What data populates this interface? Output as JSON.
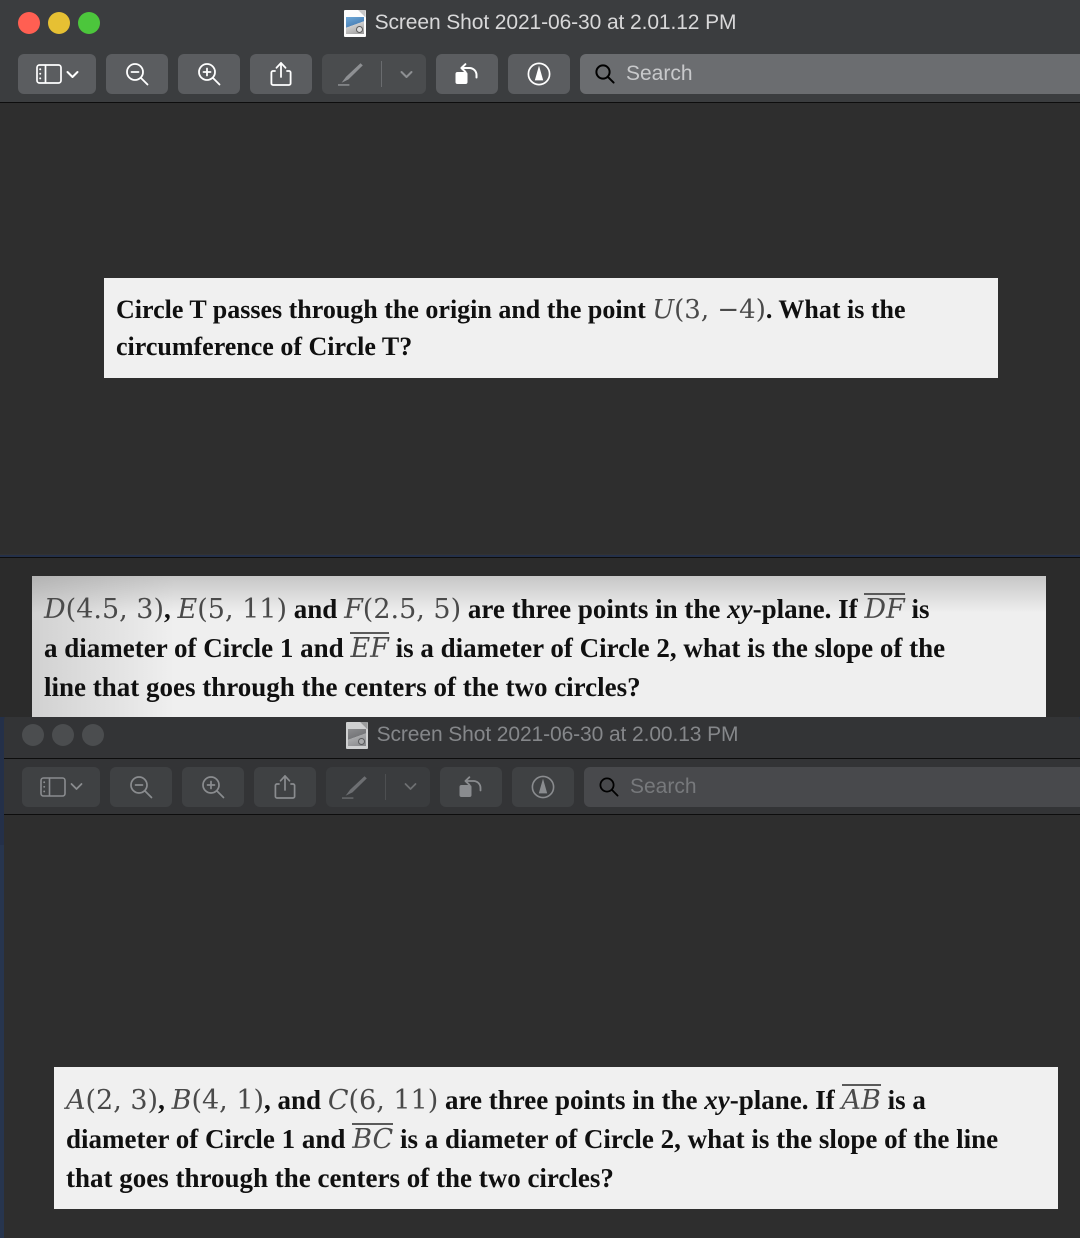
{
  "desktop": {
    "background_color": "#243049",
    "canvas_color": "#2e2e2e"
  },
  "windows": [
    {
      "id": "preview-window-front",
      "state": "active",
      "title": "Screen Shot 2021-06-30 at 2.01.12 PM",
      "title_icon": "preview-document-icon",
      "traffic_lights": {
        "close_label": "Close",
        "minimize_label": "Minimize",
        "maximize_label": "Zoom",
        "close_color": "#ff5f52",
        "minimize_color": "#e6c033",
        "maximize_color": "#4cc63c"
      },
      "toolbar": {
        "sidebar_label": "Sidebar",
        "zoom_out_label": "Zoom Out",
        "zoom_in_label": "Zoom In",
        "share_label": "Share",
        "markup_label": "Markup",
        "markup_menu_label": "Markup Options",
        "rotate_label": "Rotate Left",
        "annotate_label": "Annotate",
        "search_placeholder": "Search",
        "search_value": ""
      },
      "content": {
        "snippet": {
          "lines": [
            [
              {
                "t": "text",
                "v": "Circle T passes through the origin and the point "
              },
              {
                "t": "math",
                "v": "U"
              },
              {
                "t": "math",
                "v": "(3, −4)"
              },
              {
                "t": "text",
                "v": ". What is the"
              }
            ],
            [
              {
                "t": "text",
                "v": "circumference of Circle T?"
              }
            ]
          ],
          "plain": "Circle T passes through the origin and the point U(3, −4). What is the circumference of Circle T?"
        }
      }
    },
    {
      "id": "preview-window-middle",
      "state": "background",
      "content": {
        "snippet": {
          "lines": [
            [
              {
                "t": "math",
                "v": "D"
              },
              {
                "t": "math",
                "v": "(4.5, 3)"
              },
              {
                "t": "text",
                "v": ", "
              },
              {
                "t": "math",
                "v": "E"
              },
              {
                "t": "math",
                "v": "(5, 11)"
              },
              {
                "t": "text",
                "v": " and "
              },
              {
                "t": "math",
                "v": "F"
              },
              {
                "t": "math",
                "v": "(2.5, 5)"
              },
              {
                "t": "text",
                "v": " are three points in the "
              },
              {
                "t": "italic",
                "v": "xy"
              },
              {
                "t": "text",
                "v": "-plane. If "
              },
              {
                "t": "overline",
                "v": "DF"
              },
              {
                "t": "text",
                "v": " is"
              }
            ],
            [
              {
                "t": "text",
                "v": "a diameter of Circle 1 and "
              },
              {
                "t": "overline",
                "v": "EF"
              },
              {
                "t": "text",
                "v": " is a diameter of Circle 2, what is the slope of the"
              }
            ],
            [
              {
                "t": "text",
                "v": "line that goes through the centers of the two circles?"
              }
            ]
          ],
          "plain": "D(4.5,3), E(5, 11) and F(2.5, 5) are three points in the xy-plane. If DF is a diameter of Circle 1 and EF is a diameter of Circle 2, what is the slope of the line that goes through the centers of the two circles?"
        }
      }
    },
    {
      "id": "preview-window-back",
      "state": "inactive",
      "title": "Screen Shot 2021-06-30 at 2.00.13 PM",
      "title_icon": "preview-document-icon",
      "traffic_lights": {
        "close_label": "Close",
        "minimize_label": "Minimize",
        "maximize_label": "Zoom",
        "dim_color": "#4b4d4f"
      },
      "toolbar": {
        "sidebar_label": "Sidebar",
        "zoom_out_label": "Zoom Out",
        "zoom_in_label": "Zoom In",
        "share_label": "Share",
        "markup_label": "Markup",
        "markup_menu_label": "Markup Options",
        "rotate_label": "Rotate Left",
        "annotate_label": "Annotate",
        "search_placeholder": "Search",
        "search_value": ""
      },
      "content": {
        "snippet": {
          "lines": [
            [
              {
                "t": "math",
                "v": "A"
              },
              {
                "t": "math",
                "v": "(2, 3)"
              },
              {
                "t": "text",
                "v": ", "
              },
              {
                "t": "math",
                "v": "B"
              },
              {
                "t": "math",
                "v": "(4, 1)"
              },
              {
                "t": "text",
                "v": ", and "
              },
              {
                "t": "math",
                "v": "C"
              },
              {
                "t": "math",
                "v": "(6, 11)"
              },
              {
                "t": "text",
                "v": " are three points in the "
              },
              {
                "t": "italic",
                "v": "xy"
              },
              {
                "t": "text",
                "v": "-plane. If "
              },
              {
                "t": "overline",
                "v": "AB"
              },
              {
                "t": "text",
                "v": " is a"
              }
            ],
            [
              {
                "t": "text",
                "v": "diameter of Circle 1 and "
              },
              {
                "t": "overline",
                "v": "BC"
              },
              {
                "t": "text",
                "v": " is a diameter of Circle 2, what is the slope of the line"
              }
            ],
            [
              {
                "t": "text",
                "v": "that goes through the centers of the two circles?"
              }
            ]
          ],
          "plain": "A(2, 3), B(4, 1), and C(6, 11) are three points in the xy-plane. If AB is a diameter of Circle 1 and BC is a diameter of Circle 2, what is the slope of the line that goes through the centers of the two circles?"
        }
      }
    }
  ]
}
